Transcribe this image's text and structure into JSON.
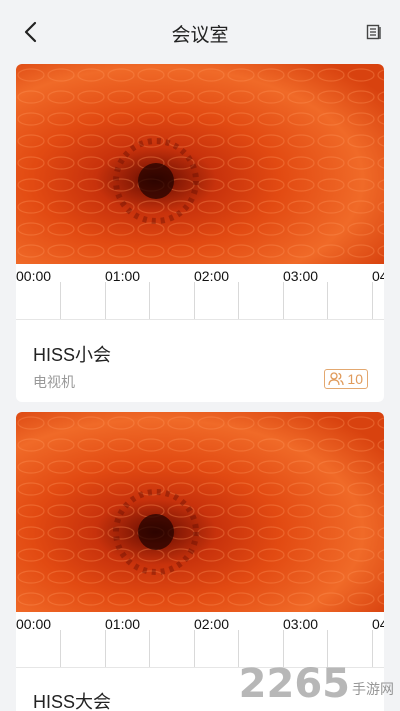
{
  "header": {
    "title": "会议室"
  },
  "timeline_labels": [
    "00:00",
    "01:00",
    "02:00",
    "03:00",
    "04"
  ],
  "rooms": [
    {
      "name": "HISS小会",
      "equipment": "电视机",
      "capacity": "10"
    },
    {
      "name": "HISS大会"
    }
  ],
  "watermark": {
    "number": "2265",
    "text": "手游网"
  },
  "colors": {
    "accent": "#e09a5a",
    "background": "#f2f3f5"
  }
}
